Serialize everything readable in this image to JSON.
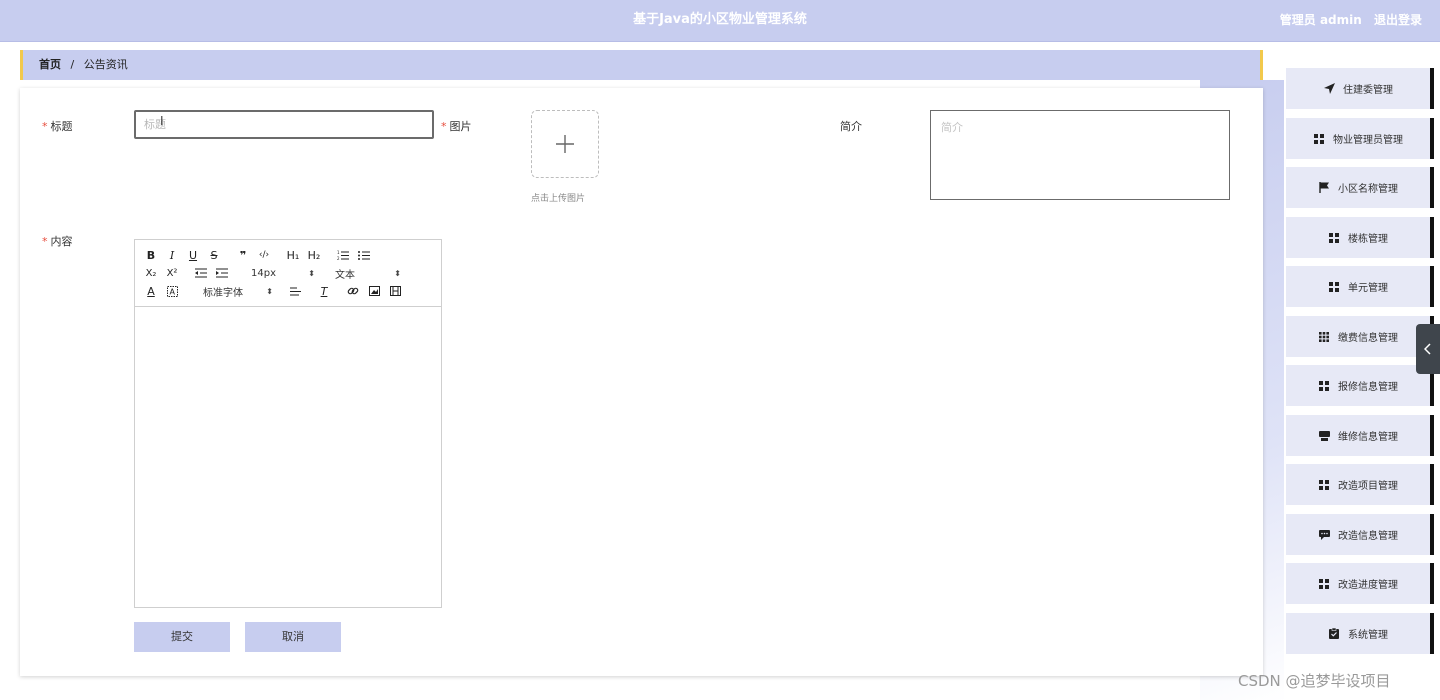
{
  "header": {
    "title": "基于Java的小区物业管理系统",
    "user_label": "管理员 admin",
    "logout_label": "退出登录"
  },
  "breadcrumb": {
    "home": "首页",
    "separator": "/",
    "current": "公告资讯"
  },
  "form": {
    "title_label": "标题",
    "title_placeholder": "标题",
    "image_label": "图片",
    "upload_hint": "点击上传图片",
    "intro_label": "简介",
    "intro_placeholder": "简介",
    "content_label": "内容",
    "required_mark": "*",
    "submit_label": "提交",
    "cancel_label": "取消"
  },
  "editor_toolbar": {
    "bold": "B",
    "italic": "I",
    "underline": "U",
    "strike": "S",
    "quote": "❞",
    "code": "‹/›",
    "h1": "H₁",
    "h2": "H₂",
    "subscript": "X₂",
    "superscript": "X²",
    "font_size": "14px",
    "text_format": "文本",
    "font_family": "标准字体"
  },
  "sidebar": {
    "items": [
      {
        "label": "住建委管理",
        "icon": "paper-plane-icon"
      },
      {
        "label": "物业管理员管理",
        "icon": "grid-icon"
      },
      {
        "label": "小区名称管理",
        "icon": "flag-icon"
      },
      {
        "label": "楼栋管理",
        "icon": "grid-icon"
      },
      {
        "label": "单元管理",
        "icon": "grid-icon"
      },
      {
        "label": "缴费信息管理",
        "icon": "grid-3x3-icon"
      },
      {
        "label": "报修信息管理",
        "icon": "grid-icon"
      },
      {
        "label": "维修信息管理",
        "icon": "box-icon"
      },
      {
        "label": "改造项目管理",
        "icon": "grid-icon"
      },
      {
        "label": "改造信息管理",
        "icon": "chat-icon"
      },
      {
        "label": "改造进度管理",
        "icon": "grid-icon"
      },
      {
        "label": "系统管理",
        "icon": "clipboard-icon"
      }
    ]
  },
  "watermark": "CSDN @追梦毕设项目",
  "colors": {
    "primary": "#c7cdef",
    "accent_border": "#f2c94c",
    "required": "#e74c3c"
  }
}
